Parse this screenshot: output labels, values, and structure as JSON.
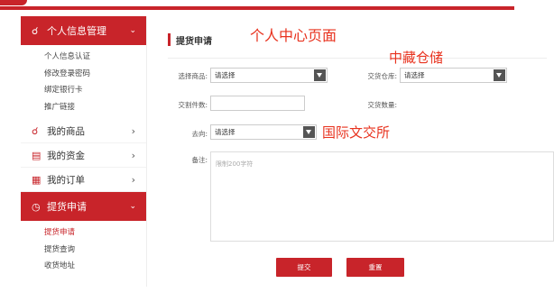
{
  "sidebar": {
    "sections": [
      {
        "label": "个人信息管理",
        "icon": "user-icon",
        "expanded": true,
        "items": [
          "个人信息认证",
          "修改登录密码",
          "绑定银行卡",
          "推广链接"
        ]
      },
      {
        "label": "我的商品",
        "icon": "users-icon"
      },
      {
        "label": "我的资金",
        "icon": "wallet-icon"
      },
      {
        "label": "我的订单",
        "icon": "order-icon"
      },
      {
        "label": "提货申请",
        "icon": "clock-icon",
        "expanded": true,
        "items": [
          "提货申请",
          "提货查询",
          "收货地址"
        ],
        "active_item": "提货申请"
      }
    ]
  },
  "main": {
    "title": "提货申请",
    "form": {
      "product_label": "选择商品:",
      "product_value": "请选择",
      "warehouse_label": "交货仓库:",
      "warehouse_value": "请选择",
      "quantity_label": "交割件数:",
      "quantity_value": "",
      "delivery_qty_label": "交货数量:",
      "destination_label": "去向:",
      "destination_value": "请选择",
      "remark_label": "备注:",
      "remark_placeholder": "限制200字符"
    },
    "buttons": {
      "submit": "提交",
      "reset": "重置"
    }
  },
  "annotations": {
    "personal_center": "个人中心页面",
    "zhongcang": "中藏仓储",
    "guoji": "国际文交所"
  },
  "colors": {
    "accent": "#c8242a",
    "annotation": "#e8321e"
  }
}
